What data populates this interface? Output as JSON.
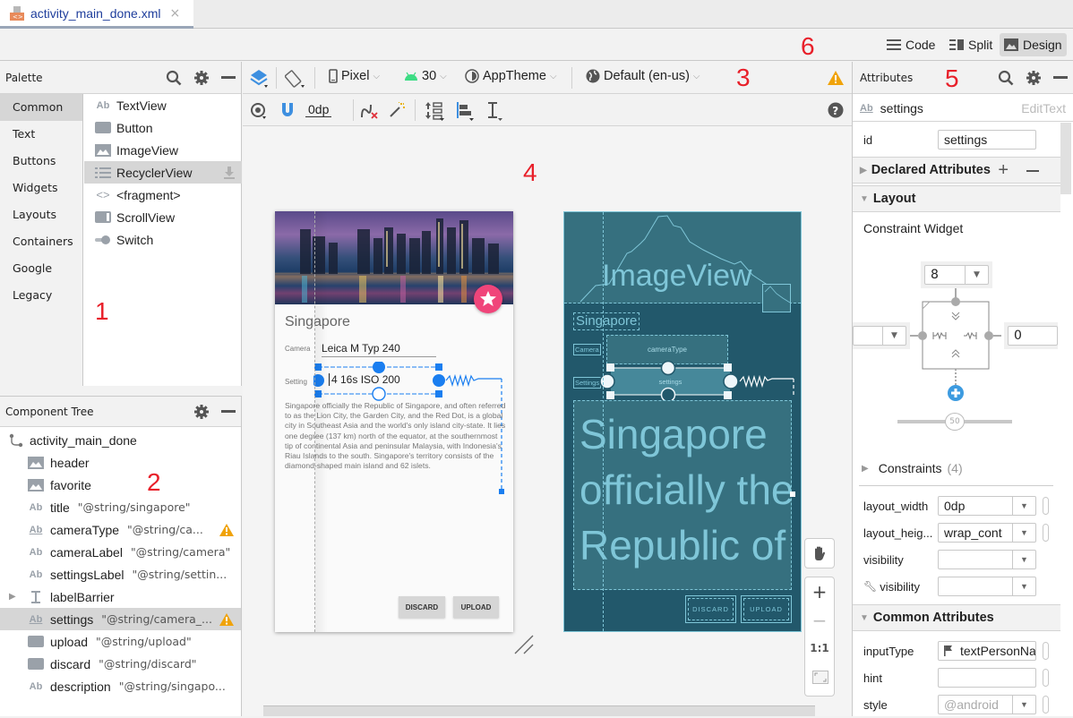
{
  "editor_tab": {
    "filename": "activity_main_done.xml",
    "close_icon": "×"
  },
  "view_modes": [
    {
      "label": "Code",
      "active": false
    },
    {
      "label": "Split",
      "active": false
    },
    {
      "label": "Design",
      "active": true
    }
  ],
  "annotations": [
    "1",
    "2",
    "3",
    "4",
    "5",
    "6"
  ],
  "palette": {
    "title": "Palette",
    "categories": [
      "Common",
      "Text",
      "Buttons",
      "Widgets",
      "Layouts",
      "Containers",
      "Google",
      "Legacy"
    ],
    "selected_category": "Common",
    "items": [
      {
        "label": "TextView",
        "icon": "textview-icon"
      },
      {
        "label": "Button",
        "icon": "button-icon"
      },
      {
        "label": "ImageView",
        "icon": "imageview-icon"
      },
      {
        "label": "RecyclerView",
        "icon": "recyclerview-icon",
        "selected": true
      },
      {
        "label": "<fragment>",
        "icon": "fragment-icon"
      },
      {
        "label": "ScrollView",
        "icon": "scrollview-icon"
      },
      {
        "label": "Switch",
        "icon": "switch-icon"
      }
    ]
  },
  "component_tree": {
    "title": "Component Tree",
    "root": "activity_main_done",
    "items": [
      {
        "name": "header",
        "ref": "",
        "icon": "image"
      },
      {
        "name": "favorite",
        "ref": "",
        "icon": "image"
      },
      {
        "name": "title",
        "ref": "\"@string/singapore\"",
        "icon": "text"
      },
      {
        "name": "cameraType",
        "ref": "\"@string/ca...",
        "icon": "edittext",
        "warning": true
      },
      {
        "name": "cameraLabel",
        "ref": "\"@string/camera\"",
        "icon": "text"
      },
      {
        "name": "settingsLabel",
        "ref": "\"@string/settin...",
        "icon": "text"
      },
      {
        "name": "labelBarrier",
        "ref": "",
        "icon": "barrier",
        "expandable": true
      },
      {
        "name": "settings",
        "ref": "\"@string/camera_...",
        "icon": "edittext",
        "warning": true,
        "selected": true
      },
      {
        "name": "upload",
        "ref": "\"@string/upload\"",
        "icon": "button"
      },
      {
        "name": "discard",
        "ref": "\"@string/discard\"",
        "icon": "button"
      },
      {
        "name": "description",
        "ref": "\"@string/singapo...",
        "icon": "text"
      }
    ]
  },
  "toolbar": {
    "device": "Pixel",
    "api_level": "30",
    "theme": "AppTheme",
    "locale": "Default (en-us)",
    "default_margin": "0dp"
  },
  "design_preview": {
    "title": "Singapore",
    "camera_label": "Camera",
    "camera_value": "Leica M Typ 240",
    "settings_label": "Setting",
    "settings_value": "4 16s ISO 200",
    "description": "Singapore officially the Republic of Singapore, and often referred to as the Lion City, the Garden City, and the Red Dot, is a global city in Southeast Asia and the world's only island city-state. It lies one degree (137 km) north of the equator, at the southernmost tip of continental Asia and peninsular Malaysia, with Indonesia's Riau Islands to the south. Singapore's territory consists of the diamond-shaped main island and 62 islets.",
    "discard": "DISCARD",
    "upload": "UPLOAD"
  },
  "blueprint": {
    "imageview": "ImageView",
    "title": "Singapore",
    "camera": "Camera",
    "camera_type": "cameraType",
    "settings_label": "Settings",
    "settings": "settings",
    "big_text": [
      "Singapore",
      "officially the",
      "Republic of"
    ],
    "discard": "DISCARD",
    "upload": "UPLOAD"
  },
  "zoom_controls": {
    "plus": "+",
    "minus": "−",
    "one_to_one": "1:1"
  },
  "attributes": {
    "title": "Attributes",
    "component_name": "settings",
    "component_type": "EditText",
    "id_label": "id",
    "id_value": "settings",
    "declared_section": "Declared Attributes",
    "layout_section": "Layout",
    "constraint_widget": "Constraint Widget",
    "margin_top": "8",
    "margin_left": "",
    "margin_right": "0",
    "bias": "50",
    "constraints_label": "Constraints",
    "constraints_count": "(4)",
    "rows": [
      {
        "label": "layout_width",
        "value": "0dp",
        "dropdown": true
      },
      {
        "label": "layout_heig...",
        "value": "wrap_cont",
        "dropdown": true
      },
      {
        "label": "visibility",
        "value": "",
        "dropdown": true
      },
      {
        "label": "visibility",
        "value": "",
        "dropdown": true,
        "tool": true
      }
    ],
    "common_section": "Common Attributes",
    "common_rows": [
      {
        "label": "inputType",
        "value": "textPersonNa",
        "flag": true
      },
      {
        "label": "hint",
        "value": ""
      },
      {
        "label": "style",
        "value": "@android",
        "dropdown": true
      }
    ]
  },
  "colors": {
    "accent": "#3d8fe0",
    "warning": "#f0a30a",
    "blueprint": "#22586b",
    "favorite": "#f0457a",
    "annotation": "#e8202a"
  }
}
